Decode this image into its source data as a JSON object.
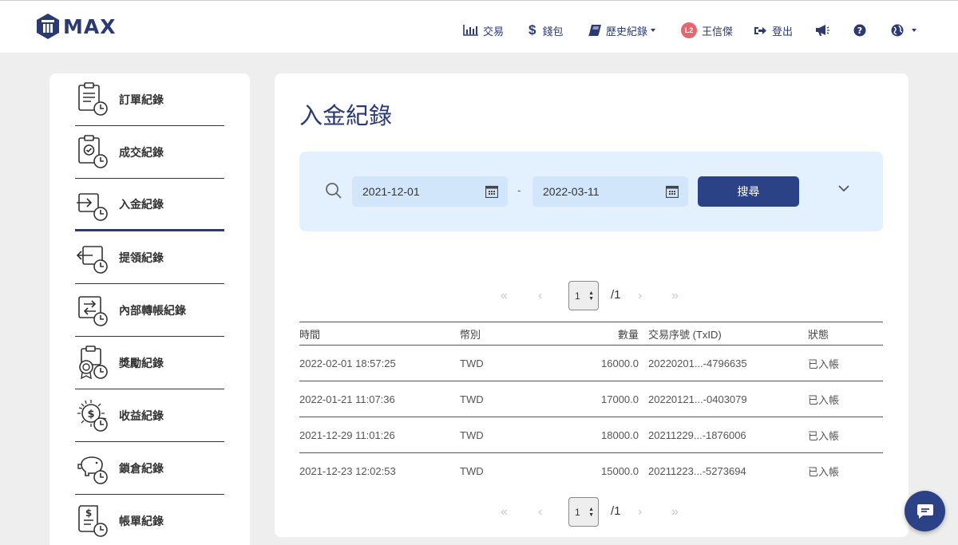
{
  "brand": {
    "name": "MAX",
    "color": "#2b3a73"
  },
  "nav": [
    {
      "label": "交易",
      "icon": "bar-chart-icon"
    },
    {
      "label": "錢包",
      "icon": "dollar-icon"
    },
    {
      "label": "歷史紀錄",
      "icon": "book-icon",
      "dropdown": true
    },
    {
      "label": "王信傑",
      "icon": "avatar",
      "avatar_text": "L2"
    },
    {
      "label": "登出",
      "icon": "sign-out-icon"
    },
    {
      "label": "",
      "icon": "megaphone-icon"
    },
    {
      "label": "",
      "icon": "help-icon"
    },
    {
      "label": "",
      "icon": "globe-icon",
      "dropdown": true
    }
  ],
  "sidebar": {
    "items": [
      {
        "label": "訂單紀錄",
        "icon": "order-clipboard-icon"
      },
      {
        "label": "成交紀錄",
        "icon": "trade-check-icon"
      },
      {
        "label": "入金紀錄",
        "icon": "deposit-icon",
        "active": true
      },
      {
        "label": "提領紀錄",
        "icon": "withdraw-icon"
      },
      {
        "label": "內部轉帳紀錄",
        "icon": "transfer-icon"
      },
      {
        "label": "獎勵紀錄",
        "icon": "reward-medal-icon"
      },
      {
        "label": "收益紀錄",
        "icon": "earnings-coin-icon"
      },
      {
        "label": "鎖倉紀錄",
        "icon": "piggy-bank-icon"
      },
      {
        "label": "帳單紀錄",
        "icon": "bill-receipt-icon"
      }
    ]
  },
  "main": {
    "title": "入金紀錄",
    "search": {
      "start_date": "2021-12-01",
      "separator": "-",
      "end_date": "2022-03-11",
      "button": "搜尋"
    },
    "pagination": {
      "current": "1",
      "total": "/1"
    },
    "table": {
      "headers": {
        "time": "時間",
        "currency": "幣別",
        "amount": "數量",
        "txid": "交易序號 (TxID)",
        "status": "狀態"
      },
      "rows": [
        {
          "time": "2022-02-01 18:57:25",
          "currency": "TWD",
          "amount": "16000.0",
          "txid": "20220201...-4796635",
          "status": "已入帳"
        },
        {
          "time": "2022-01-21 11:07:36",
          "currency": "TWD",
          "amount": "17000.0",
          "txid": "20220121...-0403079",
          "status": "已入帳"
        },
        {
          "time": "2021-12-29 11:01:26",
          "currency": "TWD",
          "amount": "18000.0",
          "txid": "20211229...-1876006",
          "status": "已入帳"
        },
        {
          "time": "2021-12-23 12:02:53",
          "currency": "TWD",
          "amount": "15000.0",
          "txid": "20211223...-5273694",
          "status": "已入帳"
        }
      ]
    }
  },
  "colors": {
    "primary": "#2b4287",
    "panel": "#e3f0fd",
    "input": "#d2e6fb",
    "avatar": "#e8646f"
  }
}
